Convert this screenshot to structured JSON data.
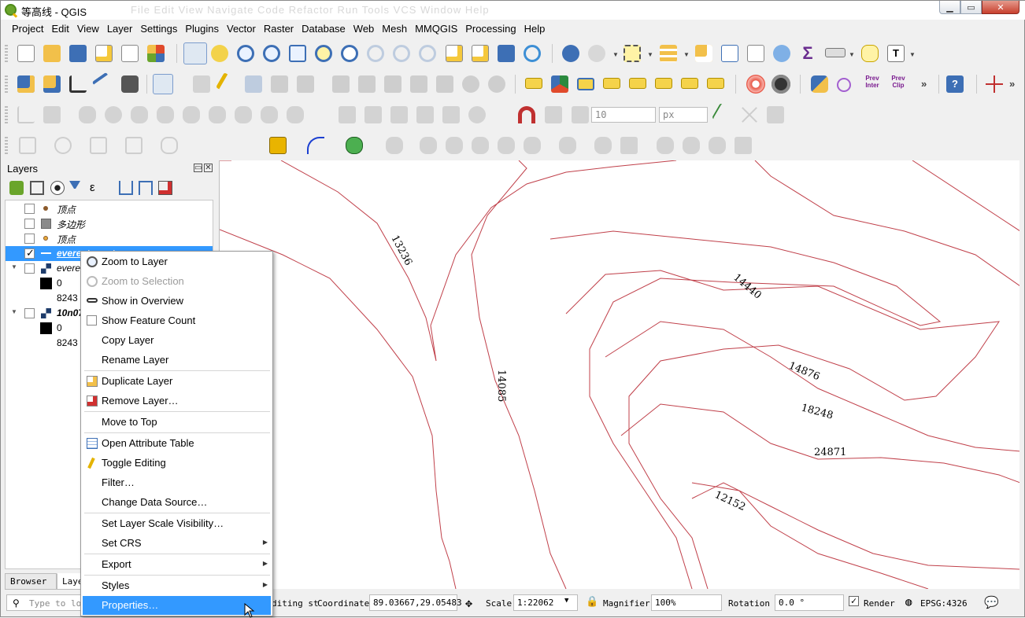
{
  "window": {
    "title": "等高线 - QGIS",
    "ghost_menu": "File  Edit  View  Navigate  Code  Refactor  Run  Tools  VCS  Window  Help"
  },
  "menubar": [
    "Project",
    "Edit",
    "View",
    "Layer",
    "Settings",
    "Plugins",
    "Vector",
    "Raster",
    "Database",
    "Web",
    "Mesh",
    "MMQGIS",
    "Processing",
    "Help"
  ],
  "toolbar4": {
    "snap_tolerance": "10",
    "unit": "px"
  },
  "toolbar3": {
    "prev_inter": "Prev Inter",
    "prev_clip": "Prev Clip"
  },
  "layers_panel": {
    "title": "Layers",
    "rows": [
      {
        "label": "顶点"
      },
      {
        "label": "多边形"
      },
      {
        "label": "顶点"
      },
      {
        "label": "everest_contour"
      },
      {
        "label": "everest"
      },
      {
        "label": "0"
      },
      {
        "label": "8243"
      },
      {
        "label": "10n070e"
      },
      {
        "label": "0"
      },
      {
        "label": "8243"
      }
    ]
  },
  "bottom_tabs": {
    "browser": "Browser",
    "layers": "Layers"
  },
  "locator_placeholder": "Type to locate",
  "context_menu": {
    "items": [
      {
        "label": "Zoom to Layer",
        "icon": "zoom-layer-icon",
        "disabled": false
      },
      {
        "label": "Zoom to Selection",
        "icon": "zoom-selection-icon",
        "disabled": true
      },
      {
        "label": "Show in Overview",
        "icon": "overview-glasses-icon",
        "disabled": false
      },
      {
        "label": "Show Feature Count",
        "icon": "checkbox-icon",
        "disabled": false
      },
      {
        "label": "Copy Layer",
        "icon": "",
        "disabled": false
      },
      {
        "label": "Rename Layer",
        "icon": "",
        "disabled": false
      },
      {
        "label": "Duplicate Layer",
        "icon": "duplicate-layer-icon",
        "disabled": false
      },
      {
        "label": "Remove Layer…",
        "icon": "remove-layer-icon",
        "disabled": false
      },
      {
        "label": "Move to Top",
        "icon": "",
        "disabled": false
      },
      {
        "label": "Open Attribute Table",
        "icon": "attribute-table-icon",
        "disabled": false
      },
      {
        "label": "Toggle Editing",
        "icon": "pencil-icon",
        "disabled": false
      },
      {
        "label": "Filter…",
        "icon": "",
        "disabled": false
      },
      {
        "label": "Change Data Source…",
        "icon": "",
        "disabled": false
      },
      {
        "label": "Set Layer Scale Visibility…",
        "icon": "",
        "disabled": false
      },
      {
        "label": "Set CRS",
        "icon": "",
        "disabled": false,
        "submenu": true
      },
      {
        "label": "Export",
        "icon": "",
        "disabled": false,
        "submenu": true
      },
      {
        "label": "Styles",
        "icon": "",
        "disabled": false,
        "submenu": true
      },
      {
        "label": "Properties…",
        "icon": "",
        "disabled": false,
        "highlighted": true
      }
    ]
  },
  "map": {
    "contour_labels": [
      "13236",
      "14440",
      "14085",
      "14876",
      "18248",
      "24871",
      "12152"
    ],
    "line_color": "#c0404a"
  },
  "statusbar": {
    "coordinate_prefix": "diting st",
    "coordinate_label": "Coordinate",
    "coordinate_value": "89.03667,29.05483",
    "scale_label": "Scale",
    "scale_value": "1:22062",
    "magnifier_label": "Magnifier",
    "magnifier_value": "100%",
    "rotation_label": "Rotation",
    "rotation_value": "0.0 °",
    "render_label": "Render",
    "crs": "EPSG:4326"
  }
}
